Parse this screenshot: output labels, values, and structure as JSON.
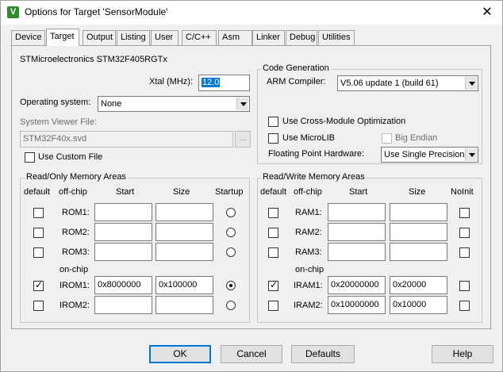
{
  "window": {
    "title": "Options for Target 'SensorModule'",
    "close": "✕",
    "icon": "V"
  },
  "tabs": [
    "Device",
    "Target",
    "Output",
    "Listing",
    "User",
    "C/C++",
    "Asm",
    "Linker",
    "Debug",
    "Utilities"
  ],
  "active_tab": "Target",
  "target": {
    "device_name": "STMicroelectronics STM32F405RGTx",
    "xtal_label": "Xtal (MHz):",
    "xtal_value": "12.0",
    "os_label": "Operating system:",
    "os_value": "None",
    "svd_label": "System Viewer File:",
    "svd_value": "STM32F40x.svd",
    "browse": "...",
    "custom_file_label": "Use Custom File"
  },
  "code_gen": {
    "legend": "Code Generation",
    "compiler_label": "ARM Compiler:",
    "compiler_value": "V5.06 update 1 (build 61)",
    "cross_module": "Use Cross-Module Optimization",
    "microlib": "Use MicroLIB",
    "big_endian": "Big Endian",
    "fp_label": "Floating Point Hardware:",
    "fp_value": "Use Single Precision"
  },
  "ro_mem": {
    "legend": "Read/Only Memory Areas",
    "headers": {
      "default": "default",
      "offchip": "off-chip",
      "start": "Start",
      "size": "Size",
      "last": "Startup"
    },
    "onchip_label": "on-chip",
    "rows": [
      {
        "name": "ROM1:",
        "start": "",
        "size": ""
      },
      {
        "name": "ROM2:",
        "start": "",
        "size": ""
      },
      {
        "name": "ROM3:",
        "start": "",
        "size": ""
      },
      {
        "name": "IROM1:",
        "start": "0x8000000",
        "size": "0x100000"
      },
      {
        "name": "IROM2:",
        "start": "",
        "size": ""
      }
    ]
  },
  "rw_mem": {
    "legend": "Read/Write Memory Areas",
    "headers": {
      "default": "default",
      "offchip": "off-chip",
      "start": "Start",
      "size": "Size",
      "last": "NoInit"
    },
    "onchip_label": "on-chip",
    "rows": [
      {
        "name": "RAM1:",
        "start": "",
        "size": ""
      },
      {
        "name": "RAM2:",
        "start": "",
        "size": ""
      },
      {
        "name": "RAM3:",
        "start": "",
        "size": ""
      },
      {
        "name": "IRAM1:",
        "start": "0x20000000",
        "size": "0x20000"
      },
      {
        "name": "IRAM2:",
        "start": "0x10000000",
        "size": "0x10000"
      }
    ]
  },
  "buttons": {
    "ok": "OK",
    "cancel": "Cancel",
    "defaults": "Defaults",
    "help": "Help"
  },
  "colors": {
    "selection": "#0078d7",
    "title_icon": "#2e8b2e"
  }
}
